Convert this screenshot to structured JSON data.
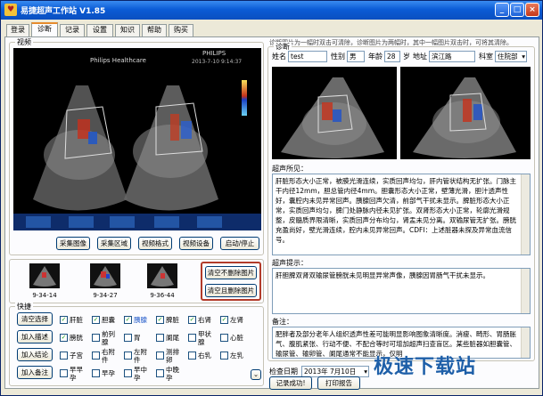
{
  "window": {
    "title": "易捷超声工作站 V1.85",
    "minimize": "_",
    "maximize": "□",
    "close": "×"
  },
  "tabs": [
    "登录",
    "诊断",
    "记录",
    "设置",
    "知识",
    "帮助",
    "购买"
  ],
  "video": {
    "label": "视频",
    "brand": "PHILIPS",
    "hospital": "Philips Healthcare",
    "timestamp": "2013-7-10 9:14:37",
    "buttons": [
      "采集图像",
      "采集区域",
      "视频格式",
      "视频设备",
      "启动/停止"
    ]
  },
  "thumbs": {
    "captions": [
      "9-34-14",
      "9-34-27",
      "9-36-44"
    ],
    "clear_keep": "清空不删除图片",
    "clear_delete": "清空且删除图片"
  },
  "quick": {
    "label": "快捷",
    "actions": [
      "清空选择",
      "加入描述",
      "加入结论",
      "加入备注"
    ],
    "rows": [
      [
        {
          "t": "肝脏",
          "c": true
        },
        {
          "t": "胆囊",
          "c": true
        },
        {
          "t": "胰腺",
          "c": true,
          "blue": true
        },
        {
          "t": "脾脏",
          "c": true
        },
        {
          "t": "右肾",
          "c": true
        },
        {
          "t": "左肾",
          "c": true
        }
      ],
      [
        {
          "t": "膀胱",
          "c": true
        },
        {
          "t": "前列腺",
          "c": false
        },
        {
          "t": "胃",
          "c": false
        },
        {
          "t": "阑尾",
          "c": false
        },
        {
          "t": "甲状腺",
          "c": false
        },
        {
          "t": "心脏",
          "c": false
        }
      ],
      [
        {
          "t": "子宫",
          "c": false
        },
        {
          "t": "右附件",
          "c": false
        },
        {
          "t": "左附件",
          "c": false
        },
        {
          "t": "测排卵",
          "c": false
        },
        {
          "t": "右乳",
          "c": false
        },
        {
          "t": "左乳",
          "c": false
        }
      ],
      [
        {
          "t": "早早孕",
          "c": false
        },
        {
          "t": "早孕",
          "c": false
        },
        {
          "t": "早中孕",
          "c": false
        },
        {
          "t": "中晚孕",
          "c": false
        }
      ]
    ]
  },
  "diagnosis": {
    "hint": "诊断图片为一幅时双击可清除，诊断图片为两幅时，其中一幅图片双击时，可将其清除。",
    "label": "诊断",
    "name_label": "姓名",
    "name": "test",
    "sex_label": "性别",
    "sex": "男",
    "age_label": "年龄",
    "age": "28",
    "age_unit": "岁",
    "addr_label": "地址",
    "addr": "滨江路",
    "dept_label": "科室",
    "dept": "住院部",
    "findings_label": "超声所见：",
    "findings": "肝脏形态大小正常，被膜光滑连续，实质回声均匀，肝内管状结构无扩张。门脉主干内径12mm，胆总管内径4mm。胆囊形态大小正常，壁薄光滑，胆汁透声性好，囊腔内未见异常回声。胰腺回声欠清，前部气干扰未显示。脾脏形态大小正常，实质回声均匀，脾门处静脉内径未见扩张。双肾形态大小正常，轮廓光滑规整，皮髓质界限清晰，实质回声分布均匀，肾盂未见分离。双输尿管无扩张。膀胱充盈尚好，壁光滑连续，腔内未见异常回声。CDFI：上述脏器未探及异常血流信号。",
    "hint_label": "超声提示：",
    "hint_text": "肝胆脾双肾双输尿管膀胱未见明显异常声像，胰腺因胃肠气干扰未显示。",
    "note_label": "备注：",
    "note_text": "肥胖者及部分老年人组织透声性差可能明显影响图象清晰度。消瘦、畸形、胃肠胀气、腹肌紧张、行动不便、不配合等时可增加超声扫查盲区。某些脏器如胆囊管、输尿管、输卵管、阑尾通常不能显示，仅明",
    "date_label": "检查日期",
    "date": "2013年 7月10日",
    "record_btn": "记录成功!",
    "print_btn": "打印报告"
  },
  "watermark": "极速下载站"
}
